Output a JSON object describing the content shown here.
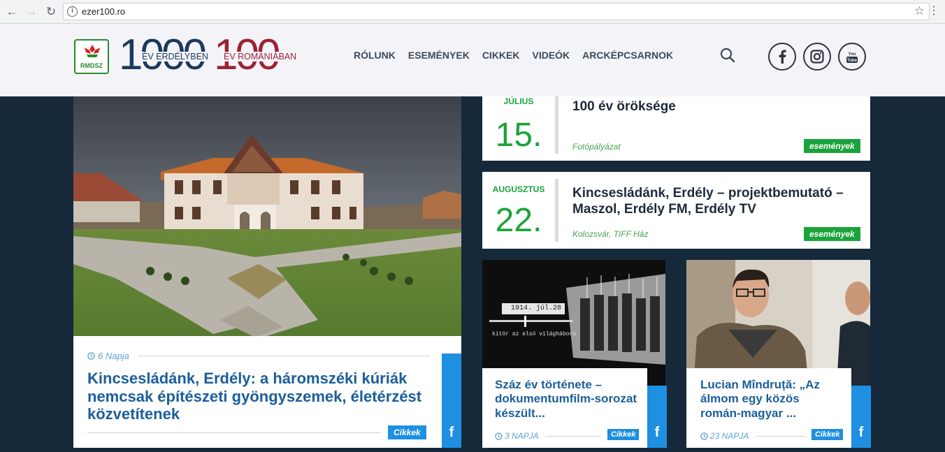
{
  "browser": {
    "url": "ezer100.ro",
    "back_icon": "arrow-left-icon",
    "forward_icon": "arrow-right-icon",
    "reload_icon": "reload-icon"
  },
  "header": {
    "logo_text": "RMDSZ",
    "num1": "1000",
    "num1_sub": "ÉV ERDÉLYBEN",
    "num2": "100",
    "num2_sub": "ÉV ROMÁNIÁBAN",
    "nav": [
      "RÓLUNK",
      "ESEMÉNYEK",
      "CIKKEK",
      "VIDEÓK",
      "ARCKÉPCSARNOK"
    ],
    "colors": {
      "navy": "#1d3a5c",
      "burgundy": "#9b2335",
      "green": "#1aa33a",
      "blue": "#1e8fe1"
    }
  },
  "hero": {
    "date": "6 Napja",
    "title": "Kincsesládánk, Erdély: a háromszéki kúriák nemcsak építészeti gyöngyszemek, életérzést közvetítenek",
    "tag": "Cikkek",
    "fb": "f"
  },
  "events": [
    {
      "month": "JÚLIUS",
      "day": "15.",
      "title": "100 év öröksége",
      "location": "Fotópályázat",
      "tag": "események"
    },
    {
      "month": "AUGUSZTUS",
      "day": "22.",
      "title": "Kincsesládánk, Erdély – projektbemutató – Maszol, Erdély FM, Erdély TV",
      "location": "Kolozsvár, TIFF Ház",
      "tag": "események"
    }
  ],
  "cards": [
    {
      "title": "Száz év története – dokumentumfilm-sorozat készült...",
      "date": "3 NAPJA",
      "tag": "Cikkek",
      "fb": "f",
      "image_caption": "1914. júl.28",
      "image_sub": "kitör az első világháború"
    },
    {
      "title": "Lucian Mîndruță: „Az álmom egy közös román-magyar ...",
      "date": "23 NAPJA",
      "tag": "Cikkek",
      "fb": "f"
    }
  ]
}
